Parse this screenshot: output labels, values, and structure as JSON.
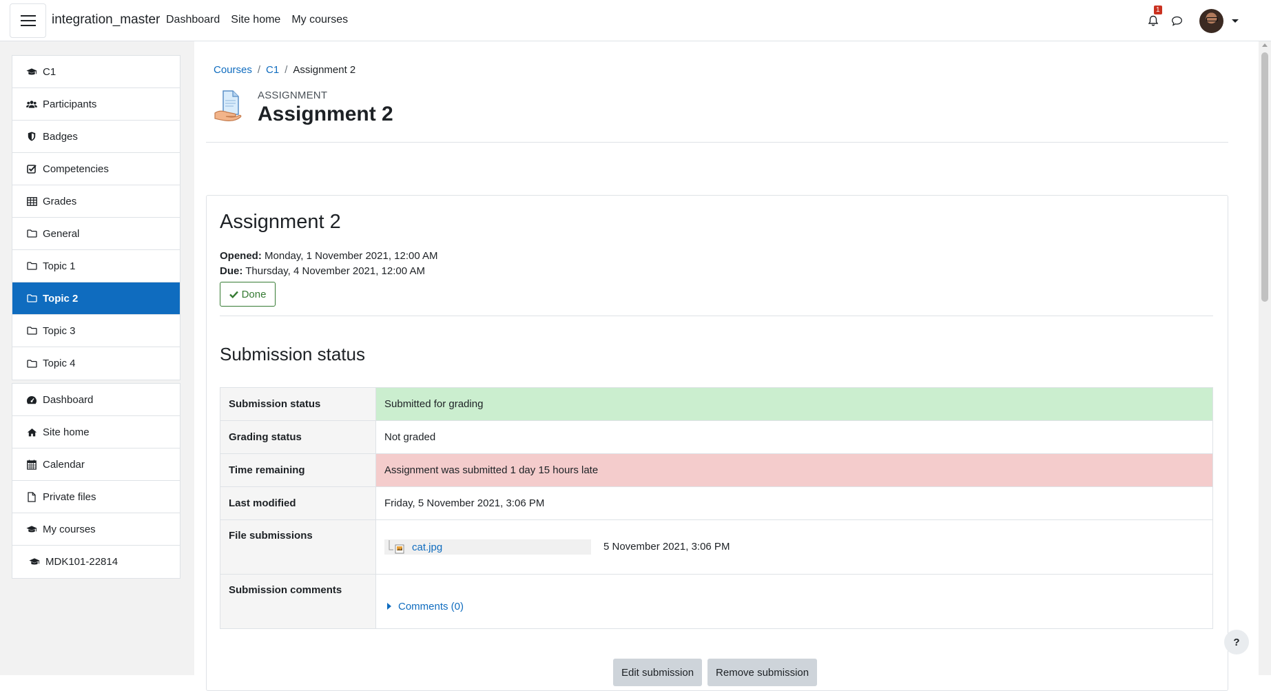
{
  "navbar": {
    "brand": "integration_master",
    "links": [
      "Dashboard",
      "Site home",
      "My courses"
    ],
    "notification_count": "1"
  },
  "drawer": {
    "course_items": [
      {
        "label": "C1",
        "icon": "graduation-cap-icon"
      },
      {
        "label": "Participants",
        "icon": "users-icon"
      },
      {
        "label": "Badges",
        "icon": "shield-icon"
      },
      {
        "label": "Competencies",
        "icon": "check-square-icon"
      },
      {
        "label": "Grades",
        "icon": "table-icon"
      },
      {
        "label": "General",
        "icon": "folder-icon"
      },
      {
        "label": "Topic 1",
        "icon": "folder-icon"
      },
      {
        "label": "Topic 2",
        "icon": "folder-icon",
        "active": true
      },
      {
        "label": "Topic 3",
        "icon": "folder-icon"
      },
      {
        "label": "Topic 4",
        "icon": "folder-icon"
      }
    ],
    "site_items": [
      {
        "label": "Dashboard",
        "icon": "tachometer-icon"
      },
      {
        "label": "Site home",
        "icon": "home-icon"
      },
      {
        "label": "Calendar",
        "icon": "calendar-icon"
      },
      {
        "label": "Private files",
        "icon": "file-icon"
      },
      {
        "label": "My courses",
        "icon": "graduation-cap-icon"
      },
      {
        "label": "MDK101-22814",
        "icon": "graduation-cap-icon"
      }
    ]
  },
  "breadcrumb": [
    "Courses",
    "C1",
    "Assignment 2"
  ],
  "header": {
    "module_type": "ASSIGNMENT",
    "title": "Assignment 2"
  },
  "assignment": {
    "title": "Assignment 2",
    "opened_label": "Opened:",
    "opened_value": " Monday, 1 November 2021, 12:00 AM",
    "due_label": "Due:",
    "due_value": " Thursday, 4 November 2021, 12:00 AM",
    "done_label": "Done"
  },
  "submission": {
    "heading": "Submission status",
    "rows": [
      {
        "label": "Submission status",
        "value": "Submitted for grading"
      },
      {
        "label": "Grading status",
        "value": "Not graded"
      },
      {
        "label": "Time remaining",
        "value": "Assignment was submitted 1 day 15 hours late"
      },
      {
        "label": "Last modified",
        "value": "Friday, 5 November 2021, 3:06 PM"
      },
      {
        "label": "File submissions",
        "file_name": "cat.jpg",
        "file_date": "5 November 2021, 3:06 PM"
      },
      {
        "label": "Submission comments",
        "comments_link": "Comments (0)"
      }
    ],
    "buttons": {
      "edit": "Edit submission",
      "remove": "Remove submission"
    }
  },
  "help": "?",
  "colors": {
    "primary": "#0f6cbf",
    "success_bg": "#cbeecf",
    "danger_bg": "#f4cccc",
    "done_green": "#357a32"
  }
}
